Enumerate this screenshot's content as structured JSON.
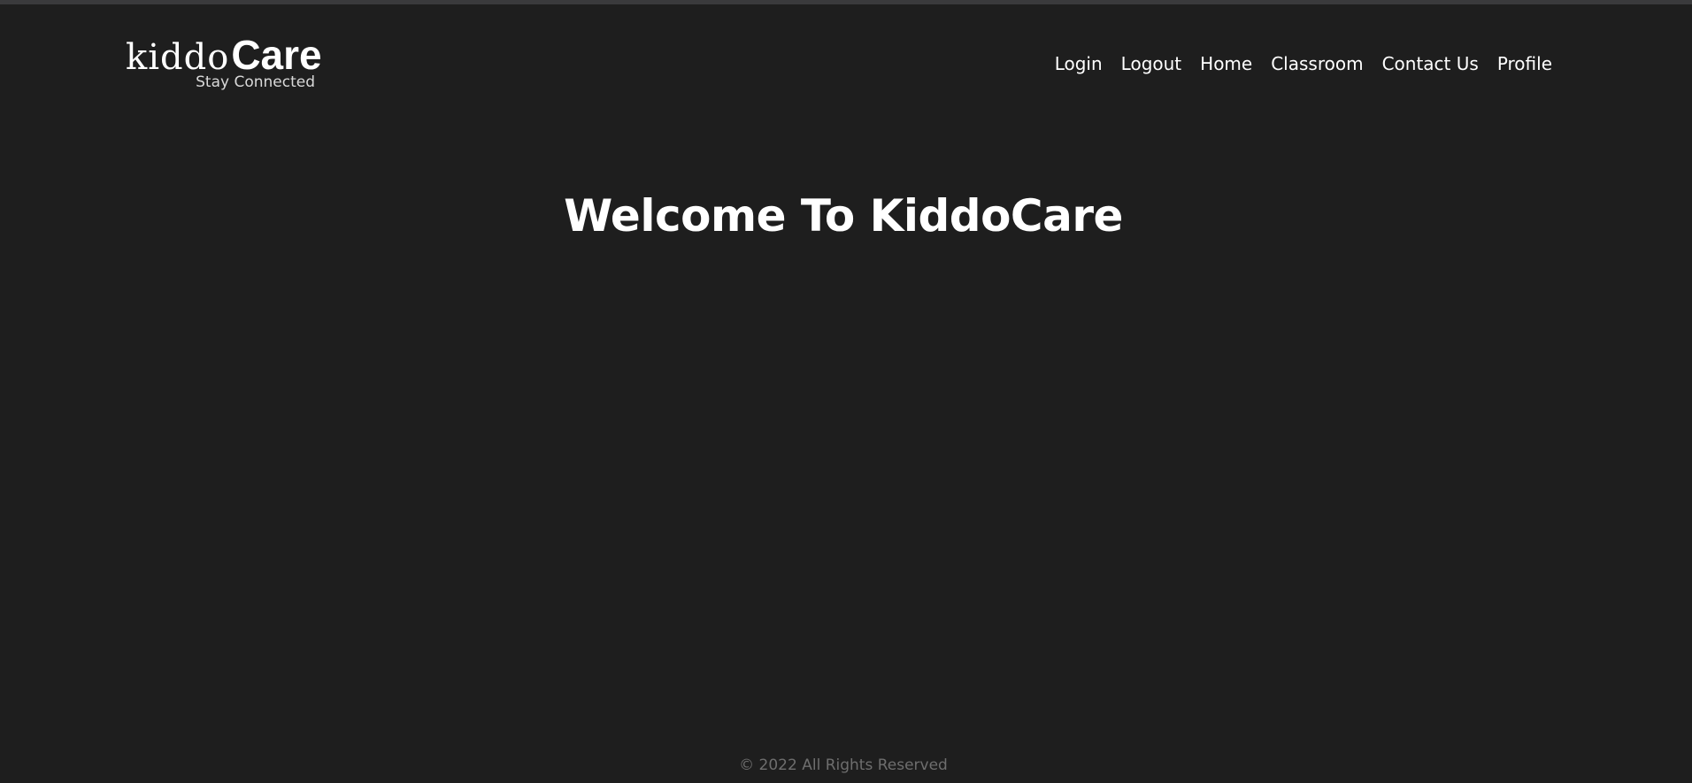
{
  "header": {
    "logo": {
      "part1": "kiddo",
      "part2": "Care",
      "tagline": "Stay Connected"
    },
    "nav": [
      {
        "label": "Login"
      },
      {
        "label": "Logout"
      },
      {
        "label": "Home"
      },
      {
        "label": "Classroom"
      },
      {
        "label": "Contact Us"
      },
      {
        "label": "Profile"
      }
    ]
  },
  "main": {
    "title": "Welcome To KiddoCare"
  },
  "footer": {
    "copyright": "© 2022 All Rights Reserved"
  },
  "colors": {
    "background": "#1e1e1e",
    "top_strip": "#3a3a3c",
    "text_primary": "#ffffff",
    "footer_text": "#6e6e6e"
  }
}
